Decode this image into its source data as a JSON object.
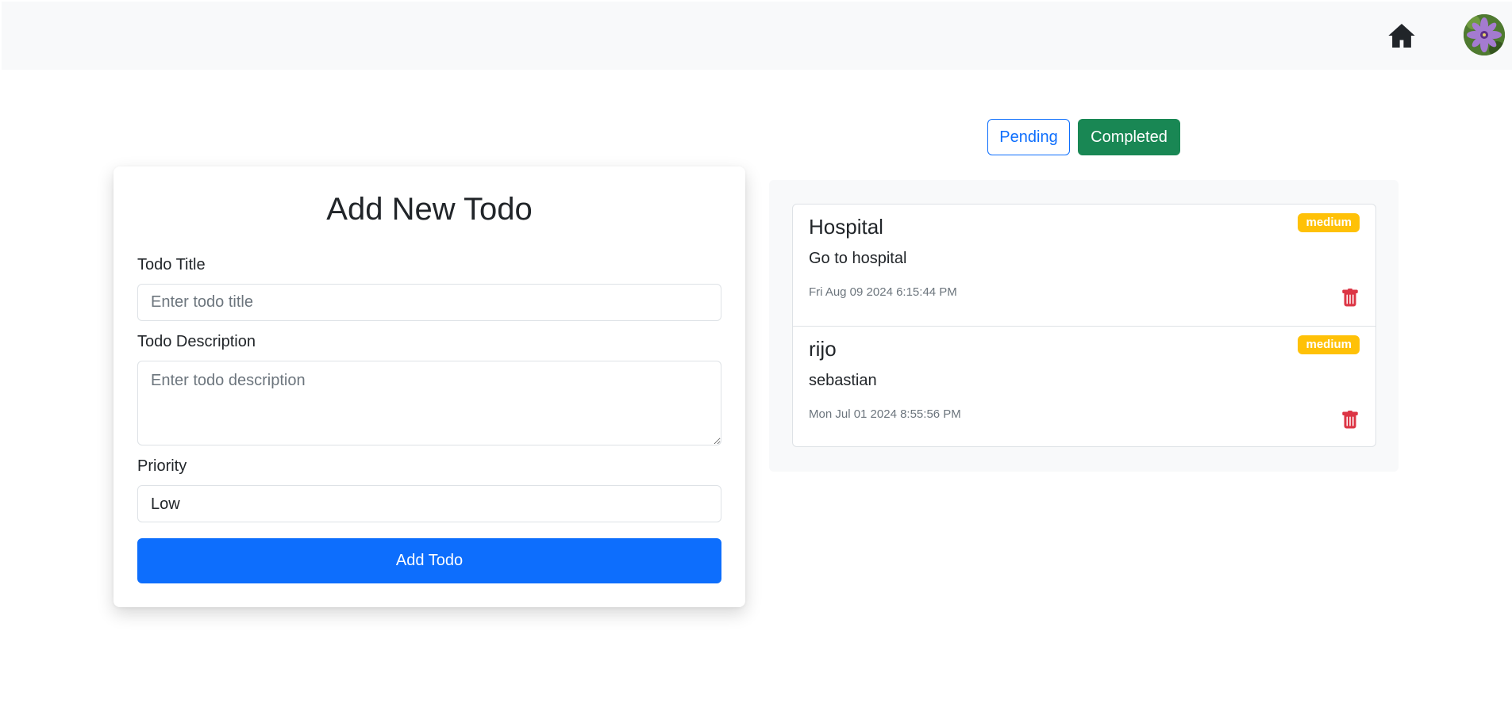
{
  "navbar": {
    "home_icon": "house-icon",
    "avatar_icon": "user-avatar"
  },
  "form": {
    "title": "Add New Todo",
    "title_label": "Todo Title",
    "title_placeholder": "Enter todo title",
    "description_label": "Todo Description",
    "description_placeholder": "Enter todo description",
    "priority_label": "Priority",
    "priority_value": "Low",
    "submit_label": "Add Todo"
  },
  "filters": {
    "pending_label": "Pending",
    "completed_label": "Completed",
    "active": "Completed"
  },
  "todos": [
    {
      "title": "Hospital",
      "priority": "medium",
      "description": "Go to hospital",
      "date": "Fri Aug 09 2024 6:15:44 PM"
    },
    {
      "title": "rijo",
      "priority": "medium",
      "description": "sebastian",
      "date": "Mon Jul 01 2024 8:55:56 PM"
    }
  ],
  "colors": {
    "primary": "#0d6efd",
    "success": "#198754",
    "warning": "#ffc107",
    "danger": "#dc3545"
  }
}
